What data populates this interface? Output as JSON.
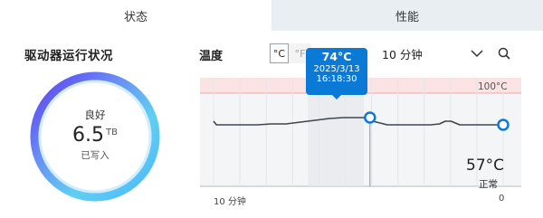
{
  "tabs": [
    {
      "label": "状态"
    },
    {
      "label": "性能"
    }
  ],
  "drive": {
    "title": "驱动器运行状况",
    "health": "良好",
    "written_value": "6.5",
    "written_unit": "TB",
    "written_label": "已写入"
  },
  "temperature": {
    "title": "温度",
    "unit_c": "°C",
    "unit_f": "°F",
    "range_selected": "10 分钟",
    "max_label": "100°C",
    "current_value": "57°C",
    "current_status": "正常",
    "x_start_label": "10 分钟",
    "x_end_label": "0",
    "tooltip": {
      "value": "74°C",
      "date": "2025/3/13",
      "time": "16:18:30"
    }
  },
  "colors": {
    "accent": "#0a7ad6",
    "line": "#3c4652",
    "danger_band": "#fbe3e3",
    "tab_inactive_bg": "#e9eef2"
  },
  "chart_data": {
    "type": "line",
    "xlabel": "",
    "ylabel": "",
    "x_range": [
      10,
      0
    ],
    "ylim": [
      0,
      100
    ],
    "series": [
      {
        "x": [
          10,
          9.9,
          9.8,
          9.5,
          9,
          8.5,
          8,
          7.5,
          7,
          6.5,
          6,
          5.5,
          5,
          4.6,
          4.5,
          4,
          3.5,
          3,
          2.5,
          2.2,
          2,
          1.8,
          1.5,
          1,
          0.5,
          0
        ],
        "values": [
          70,
          66,
          66,
          66,
          66,
          66,
          67,
          67,
          69,
          71,
          73,
          74,
          74,
          74,
          70,
          66,
          66,
          66,
          66,
          67,
          70,
          70,
          66,
          66,
          66,
          66
        ]
      }
    ],
    "highlight": {
      "x": 4.6,
      "value": 74
    },
    "grid": true
  }
}
